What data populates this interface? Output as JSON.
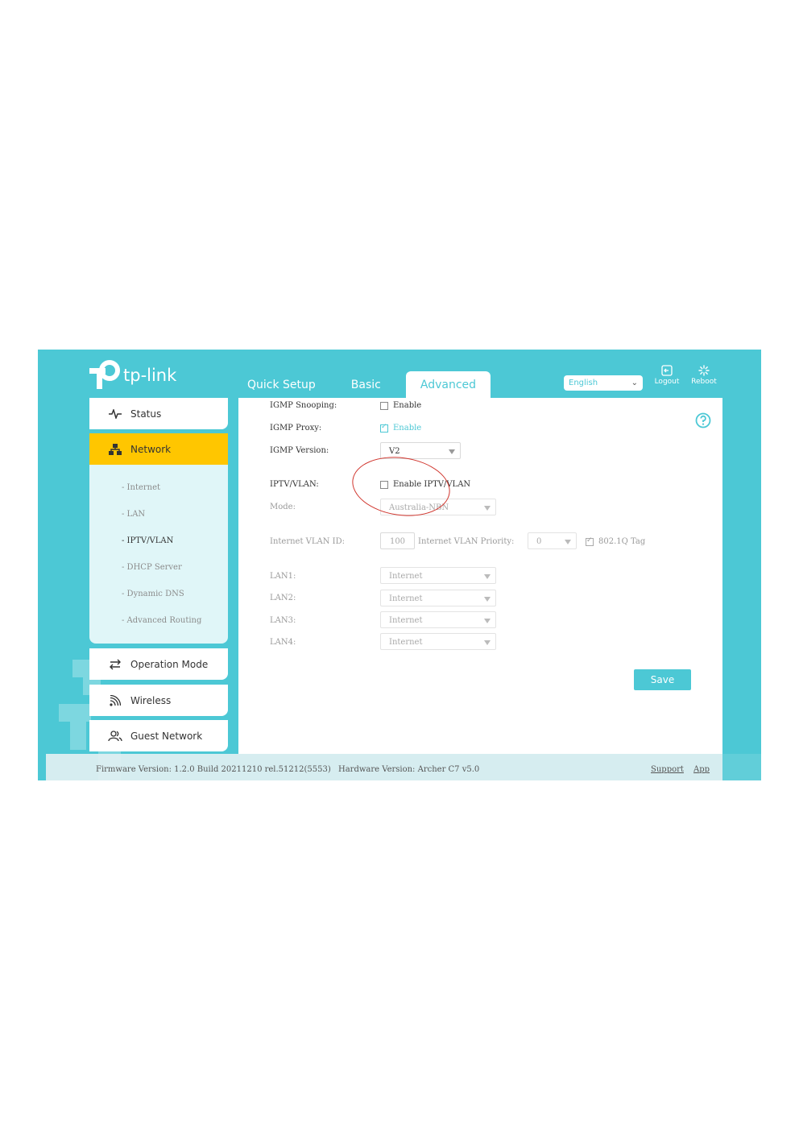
{
  "brand": {
    "name": "tp-link"
  },
  "tabs": [
    {
      "label": "Quick Setup",
      "active": false
    },
    {
      "label": "Basic",
      "active": false
    },
    {
      "label": "Advanced",
      "active": true
    }
  ],
  "header": {
    "language": "English",
    "logout_label": "Logout",
    "reboot_label": "Reboot"
  },
  "sidebar": {
    "items": [
      {
        "label": "Status",
        "icon": "status-icon"
      },
      {
        "label": "Network",
        "icon": "network-icon",
        "active": true
      },
      {
        "label": "Operation Mode",
        "icon": "operation-mode-icon"
      },
      {
        "label": "Wireless",
        "icon": "wireless-icon"
      },
      {
        "label": "Guest Network",
        "icon": "guest-network-icon"
      }
    ],
    "submenu": [
      {
        "label": "- Internet"
      },
      {
        "label": "- LAN"
      },
      {
        "label": "- IPTV/VLAN",
        "active": true
      },
      {
        "label": "- DHCP Server"
      },
      {
        "label": "- Dynamic DNS"
      },
      {
        "label": "- Advanced Routing"
      }
    ]
  },
  "form": {
    "igmp_snooping": {
      "label": "IGMP Snooping:",
      "option": "Enable",
      "checked": false
    },
    "igmp_proxy": {
      "label": "IGMP Proxy:",
      "option": "Enable",
      "checked": true
    },
    "igmp_version": {
      "label": "IGMP Version:",
      "value": "V2"
    },
    "iptv_vlan": {
      "label": "IPTV/VLAN:",
      "option": "Enable IPTV/VLAN",
      "checked": false
    },
    "mode": {
      "label": "Mode:",
      "value": "Australia-NBN"
    },
    "internet_vlan": {
      "label": "Internet VLAN ID:",
      "id_value": "100",
      "priority_label": "Internet VLAN Priority:",
      "priority_value": "0",
      "tag_label": "802.1Q Tag",
      "tag_checked": true
    },
    "lan_ports": [
      {
        "label": "LAN1:",
        "value": "Internet"
      },
      {
        "label": "LAN2:",
        "value": "Internet"
      },
      {
        "label": "LAN3:",
        "value": "Internet"
      },
      {
        "label": "LAN4:",
        "value": "Internet"
      }
    ],
    "save_label": "Save"
  },
  "footer": {
    "firmware": "Firmware Version: 1.2.0 Build 20211210 rel.51212(5553)",
    "hardware": "Hardware Version: Archer C7 v5.0",
    "support": "Support",
    "app": "App"
  },
  "colors": {
    "accent": "#4cc8d5",
    "active_nav": "#ffc600",
    "annotation": "#d0342c"
  }
}
